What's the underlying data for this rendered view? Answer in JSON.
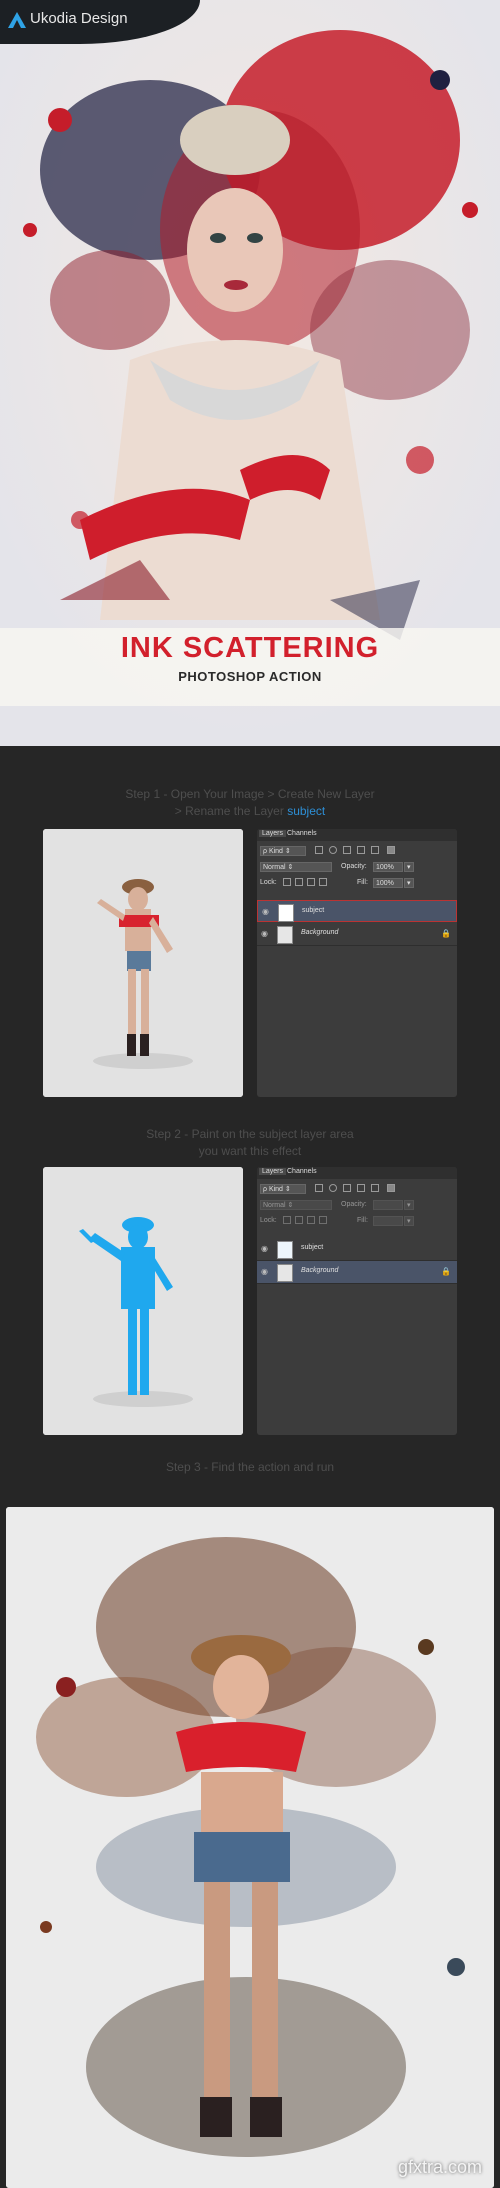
{
  "brand": {
    "name": "Ukodia Design",
    "logo_color": "#2fa3e6"
  },
  "hero": {
    "title": "INK SCATTERING",
    "subtitle": "PHOTOSHOP ACTION",
    "title_color": "#d2202c"
  },
  "step1": {
    "line1": "Step 1 - Open Your Image > Create New Layer",
    "line2": "> Rename the Layer",
    "highlight": "subject",
    "highlight_color": "#2d8fd6"
  },
  "step2": {
    "line1": "Step 2 - Paint on the subject layer area",
    "line2": "you want this effect"
  },
  "step3": {
    "line1": "Step 3 - Find the action and run"
  },
  "panel": {
    "tabs": [
      "Layers",
      "Channels"
    ],
    "filter": "Kind",
    "blend_mode": "Normal",
    "opacity_label": "Opacity:",
    "opacity_value": "100%",
    "lock_label": "Lock:",
    "fill_label": "Fill:",
    "fill_value": "100%",
    "layers": [
      "subject",
      "Background"
    ]
  },
  "panel2": {
    "filter": "Kind",
    "blend_mode": "Normal",
    "opacity_label": "Opacity:",
    "lock_label": "Lock:",
    "fill_label": "Fill:",
    "layers": [
      "subject",
      "Background"
    ]
  },
  "watermark": "gfxtra.com"
}
